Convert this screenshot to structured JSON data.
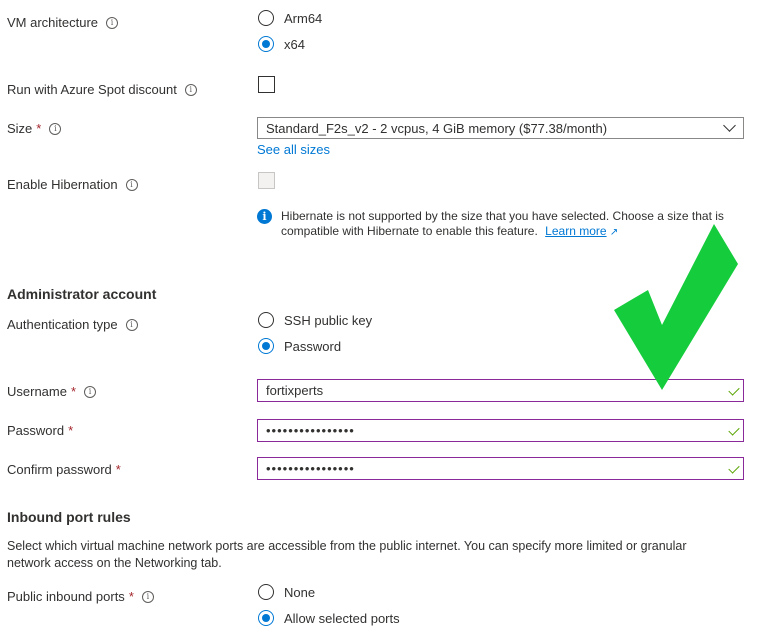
{
  "vm_architecture": {
    "label": "VM architecture",
    "options": [
      {
        "label": "Arm64",
        "selected": false
      },
      {
        "label": "x64",
        "selected": true
      }
    ]
  },
  "spot": {
    "label": "Run with Azure Spot discount",
    "checked": false
  },
  "size": {
    "label": "Size",
    "required_mark": "*",
    "value": "Standard_F2s_v2 - 2 vcpus, 4 GiB memory ($77.38/month)",
    "see_all": "See all sizes"
  },
  "hibernation": {
    "label": "Enable Hibernation",
    "checked": false,
    "disabled": true,
    "notice_line1": "Hibernate is not supported by the size that you have selected. Choose a size that is",
    "notice_line2": "compatible with Hibernate to enable this feature.",
    "learn_more": "Learn more"
  },
  "admin": {
    "heading": "Administrator account",
    "auth_label": "Authentication type",
    "auth_options": [
      {
        "label": "SSH public key",
        "selected": false
      },
      {
        "label": "Password",
        "selected": true
      }
    ],
    "username_label": "Username",
    "username_value": "fortixperts",
    "password_label": "Password",
    "password_value": "••••••••••••••••",
    "confirm_label": "Confirm password",
    "confirm_value": "••••••••••••••••",
    "required_mark": "*"
  },
  "inbound": {
    "heading": "Inbound port rules",
    "desc_line1": "Select which virtual machine network ports are accessible from the public internet. You can specify more limited or granular",
    "desc_line2": "network access on the Networking tab.",
    "ports_label": "Public inbound ports",
    "options": [
      {
        "label": "None",
        "selected": false
      },
      {
        "label": "Allow selected ports",
        "selected": true
      }
    ]
  },
  "overlay": {
    "checkmark_color": "#15cc3c"
  },
  "colors": {
    "accent": "#0078d4",
    "valid_border": "#8a2a9a",
    "required": "#a4262c"
  }
}
